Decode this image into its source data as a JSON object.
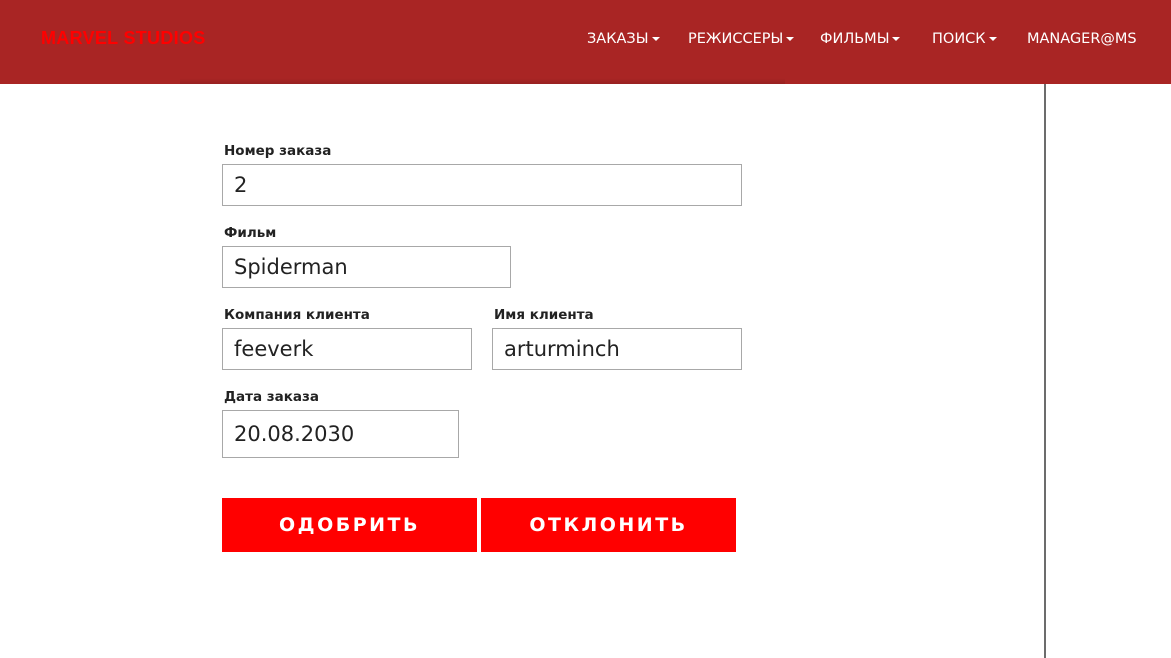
{
  "header": {
    "brand": "MARVEL STUDIOS",
    "nav": [
      {
        "label": "ЗАКАЗЫ",
        "has_dropdown": true
      },
      {
        "label": "РЕЖИССЕРЫ",
        "has_dropdown": true
      },
      {
        "label": "ФИЛЬМЫ",
        "has_dropdown": true
      },
      {
        "label": "ПОИСК",
        "has_dropdown": true
      },
      {
        "label": "MANAGER@MS",
        "has_dropdown": false
      }
    ]
  },
  "form": {
    "order_number": {
      "label": "Номер заказа",
      "value": "2"
    },
    "film": {
      "label": "Фильм",
      "value": "Spiderman"
    },
    "client_company": {
      "label": "Компания клиента",
      "value": "feeverk"
    },
    "client_name": {
      "label": "Имя клиента",
      "value": "arturminch"
    },
    "order_date": {
      "label": "Дата заказа",
      "value": "20.08.2030"
    }
  },
  "actions": {
    "approve_label": "ОДОБРИТЬ",
    "reject_label": "ОТКЛОНИТЬ"
  },
  "colors": {
    "navbar": "#a92524",
    "brand_text": "#ff0000",
    "button": "#ff0000"
  }
}
